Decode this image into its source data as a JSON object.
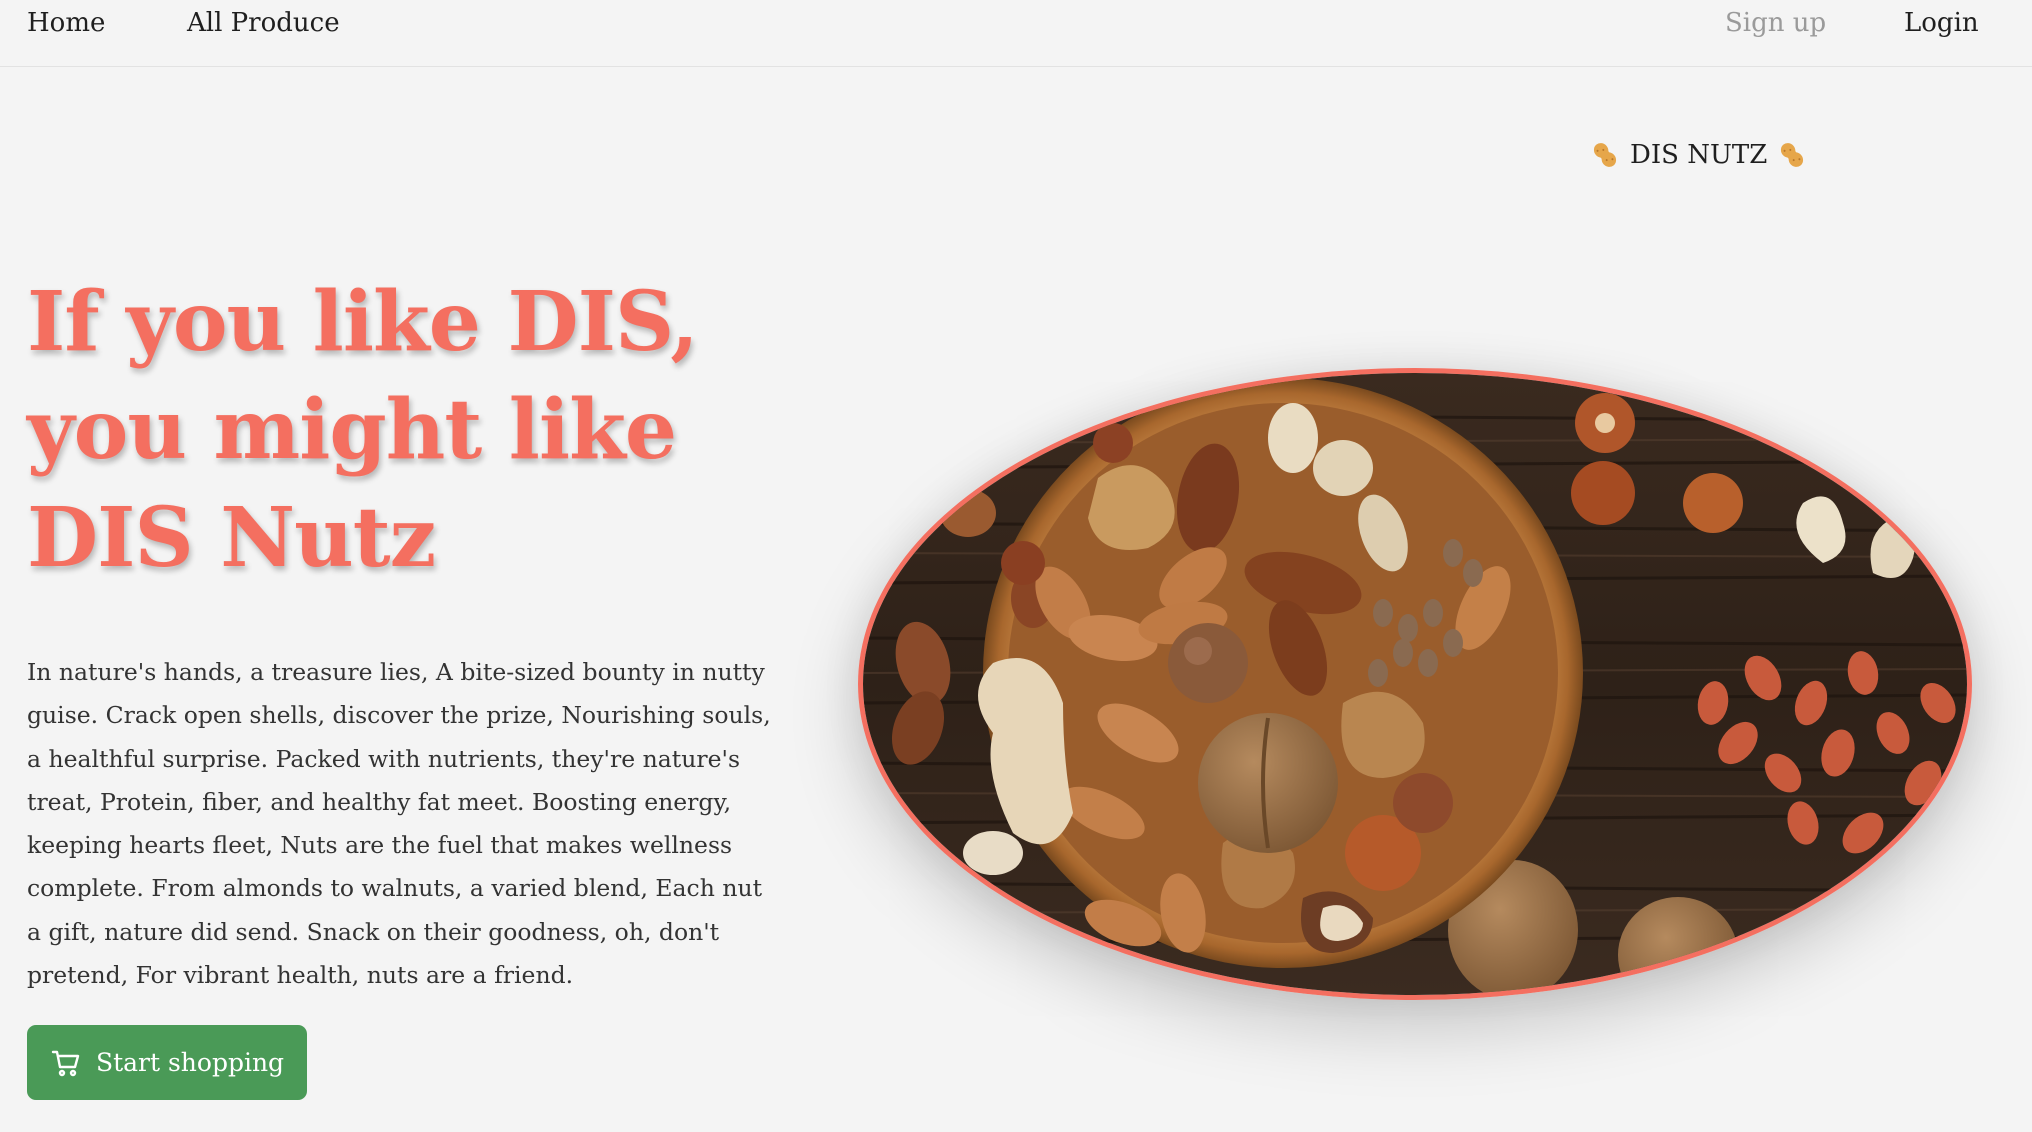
{
  "nav": {
    "home": "Home",
    "all_produce": "All Produce",
    "sign_up": "Sign up",
    "login": "Login"
  },
  "brand": {
    "name": "DIS NUTZ",
    "icon": "peanut-icon"
  },
  "hero": {
    "title": "If you like DIS, you might like DIS Nutz",
    "body": "In nature's hands, a treasure lies, A bite-sized bounty in nutty guise. Crack open shells, discover the prize, Nourishing souls, a healthful surprise. Packed with nutrients, they're nature's treat, Protein, fiber, and healthy fat meet. Boosting energy, keeping hearts fleet, Nuts are the fuel that makes wellness complete. From almonds to walnuts, a varied blend, Each nut a gift, nature did send. Snack on their goodness, oh, don't pretend, For vibrant health, nuts are a friend.",
    "cta_label": "Start shopping",
    "cta_icon": "cart-icon"
  },
  "colors": {
    "accent": "#f46f60",
    "cta": "#4a9a57",
    "background": "#f4f4f4"
  }
}
